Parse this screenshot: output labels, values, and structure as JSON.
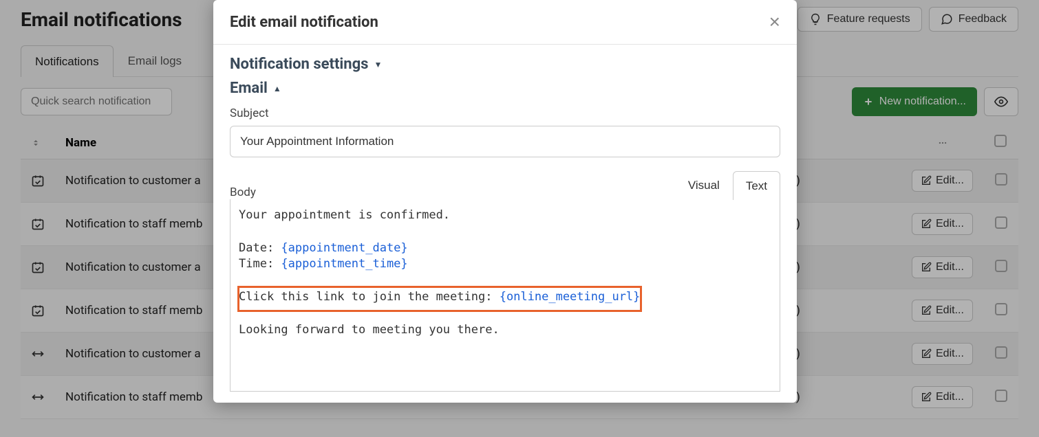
{
  "page": {
    "title": "Email notifications"
  },
  "header": {
    "feature_requests": "Feature requests",
    "feedback": "Feedback"
  },
  "tabs": {
    "notifications": "Notifications",
    "email_logs": "Email logs"
  },
  "toolbar": {
    "search_placeholder": "Quick search notification",
    "new_notification": "New notification..."
  },
  "table": {
    "columns": {
      "name": "Name"
    },
    "edit_label": "Edit...",
    "status_suffix": "able)",
    "rows": [
      {
        "name": "Notification to customer a"
      },
      {
        "name": "Notification to staff memb"
      },
      {
        "name": "Notification to customer a"
      },
      {
        "name": "Notification to staff memb"
      },
      {
        "name": "Notification to customer a"
      },
      {
        "name": "Notification to staff memb"
      }
    ]
  },
  "modal": {
    "title": "Edit email notification",
    "section_settings": "Notification settings",
    "section_email": "Email",
    "subject_label": "Subject",
    "subject_value": "Your Appointment Information",
    "body_label": "Body",
    "body_tab_visual": "Visual",
    "body_tab_text": "Text",
    "body": {
      "line1": "Your appointment is confirmed.",
      "line2": "",
      "line3_pre": "Date: ",
      "line3_token": "{appointment_date}",
      "line4_pre": "Time: ",
      "line4_token": "{appointment_time}",
      "line5": "",
      "line6_pre": "Click this link to join the meeting: ",
      "line6_token": "{online_meeting_url}",
      "line7": "",
      "line8": "Looking forward to meeting you there."
    }
  }
}
